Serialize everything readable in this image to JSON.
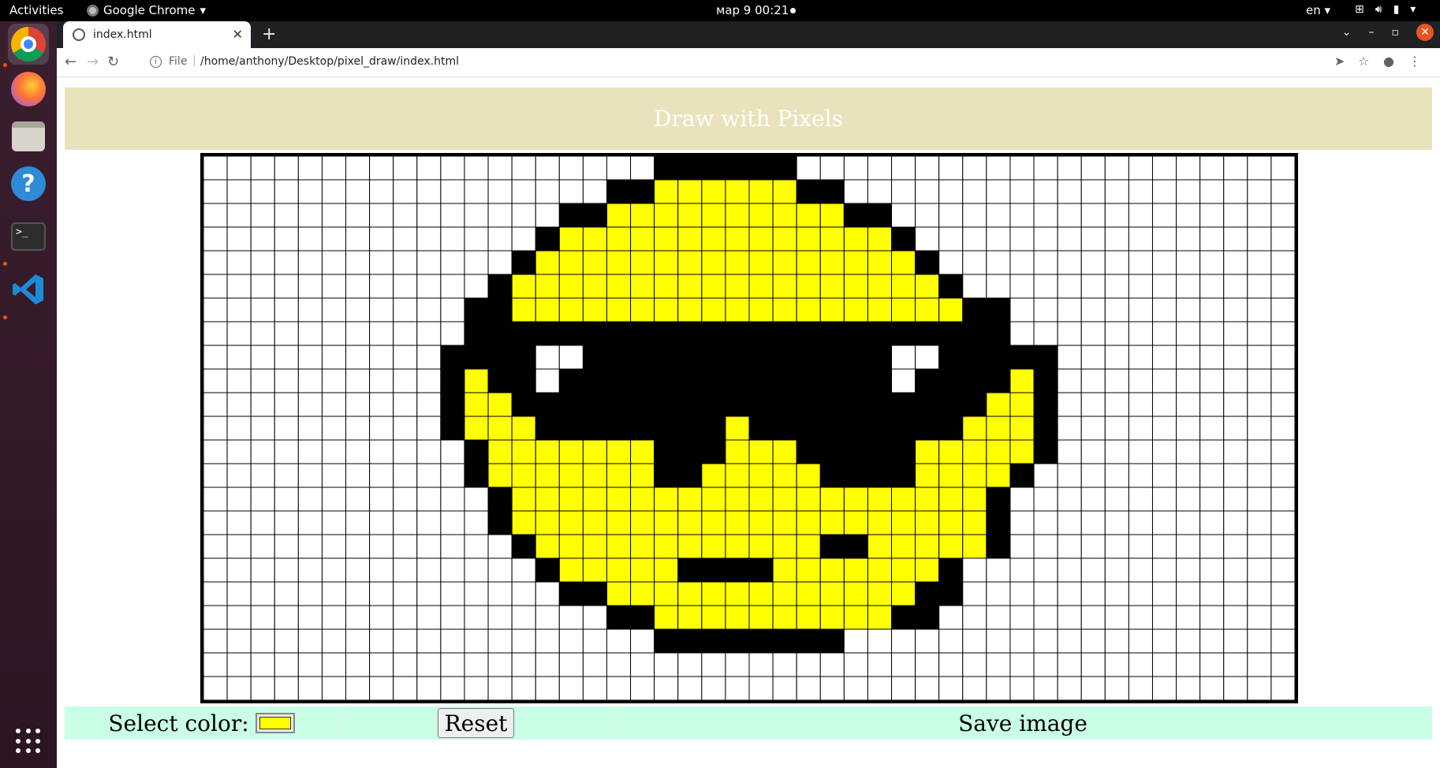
{
  "topbar": {
    "activities": "Activities",
    "app_name": "Google Chrome",
    "clock": "мар 9  00:21",
    "lang": "en"
  },
  "browser": {
    "tab_title": "index.html",
    "scheme_label": "File",
    "url": "/home/anthony/Desktop/pixel_draw/index.html"
  },
  "page": {
    "title": "Draw with Pixels",
    "select_color_label": "Select color:",
    "selected_color": "#ffff00",
    "reset_label": "Reset",
    "save_label": "Save image"
  },
  "grid": {
    "cols": 46,
    "rows": 23,
    "colors": {
      "b": "#000000",
      "y": "#ffff00",
      "w": "#ffffff"
    },
    "pixels": [
      "...................bbbbbb.....................",
      ".................bbyyyyyybb...................",
      "...............bbyyyyyyyyyybb.................",
      "..............byyyyyyyyyyyyyyb................",
      ".............byyyyyyyyyyyyyyyyb...............",
      "............byyyyyyyyyyyyyyyyyyb..............",
      "...........bbyyyyyyyyyyyyyyyyyyybb............",
      "...........bbbbbbbbbbbbbbbbbbbbbbb............",
      "..........bbbbwwbbbbbbbbbbbbbwwbbbbb..........",
      "..........bybbwbbbbbbbbbbbbbbwbbbbyb..........",
      "..........byybbbbbbbbbbbbbbbbbbbbyyb..........",
      "..........byyybbbbbbbbybbbbbbbbbyyyb..........",
      "...........byyyyyyybbbyyybbbbbyyyyyb..........",
      "...........byyyyyyybbyyyyybbbbyyyyb...........",
      "............byyyyyyyyyyyyyyyyyyyyb............",
      "............byyyyyyyyyyyyyyyyyyyyb............",
      ".............byyyyyyyyyyyybbyyyyyb.............",
      "..............byyyyybbbbyyyyyyyb..............",
      "...............bbyyyyyyyyyyyyybb..............",
      ".................bbyyyyyyyyyybb...............",
      "...................bbbbbbbb...................",
      "..............................................",
      ".............................................."
    ]
  }
}
